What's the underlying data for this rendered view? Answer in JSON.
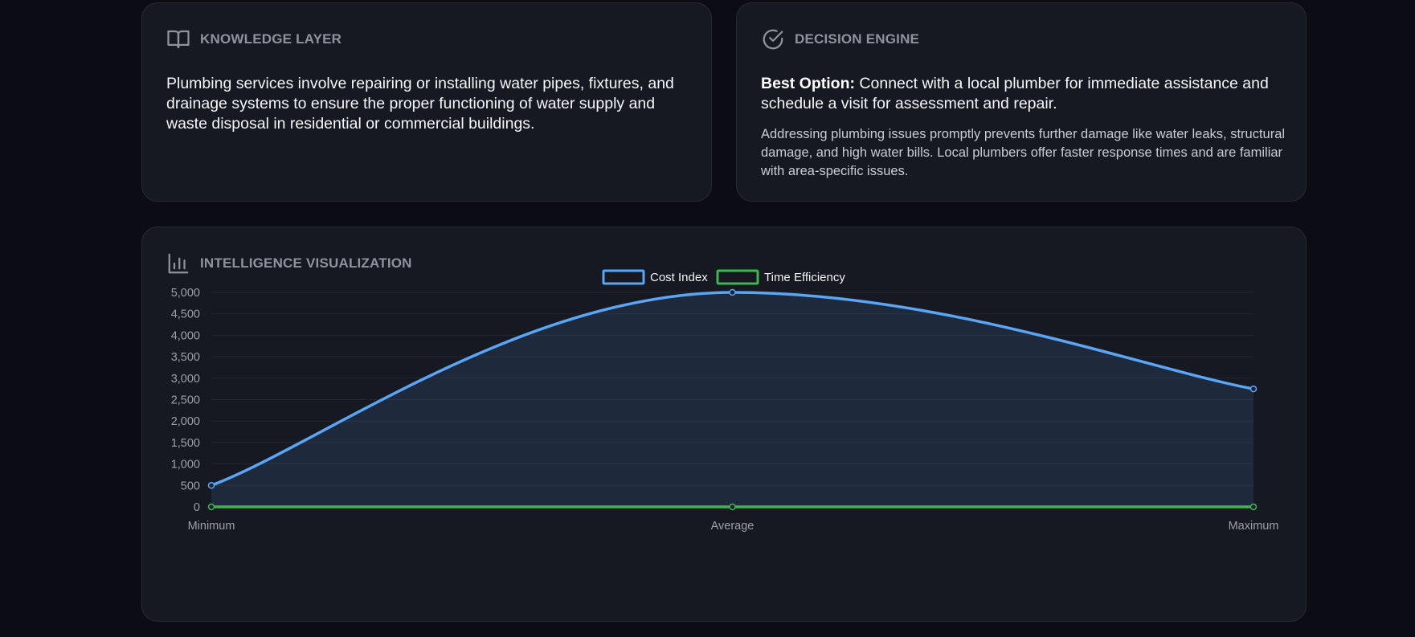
{
  "knowledge": {
    "title": "KNOWLEDGE LAYER",
    "icon": "book-open-icon",
    "text": "Plumbing services involve repairing or installing water pipes, fixtures, and drainage systems to ensure the proper functioning of water supply and waste disposal in residential or commercial buildings."
  },
  "decision": {
    "title": "DECISION ENGINE",
    "icon": "check-circle-icon",
    "best_label": "Best Option:",
    "best_text": " Connect with a local plumber for immediate assistance and schedule a visit for assessment and repair.",
    "reason": "Addressing plumbing issues promptly prevents further damage like water leaks, structural damage, and high water bills. Local plumbers offer faster response times and are familiar with area-specific issues."
  },
  "visualization": {
    "title": "INTELLIGENCE VISUALIZATION",
    "icon": "bar-chart-icon"
  },
  "colors": {
    "page_background": "#0c0d14",
    "card_background": "#161921",
    "cost_index": "#5ba5f5",
    "time_efficiency": "#3fb54f",
    "header_text": "#8e939e"
  },
  "chart_data": {
    "type": "line",
    "categories": [
      "Minimum",
      "Average",
      "Maximum"
    ],
    "series": [
      {
        "name": "Cost Index",
        "values": [
          500,
          5000,
          2750
        ],
        "color": "#5ba5f5",
        "fill": true
      },
      {
        "name": "Time Efficiency",
        "values": [
          0,
          0,
          0
        ],
        "color": "#3fb54f",
        "fill": false
      }
    ],
    "ylim": [
      0,
      5000
    ],
    "yticks": [
      "0",
      "500",
      "1,000",
      "1,500",
      "2,000",
      "2,500",
      "3,000",
      "3,500",
      "4,000",
      "4,500",
      "5,000"
    ],
    "ytick_values": [
      0,
      500,
      1000,
      1500,
      2000,
      2500,
      3000,
      3500,
      4000,
      4500,
      5000
    ],
    "grid": true,
    "legend_position": "top-center",
    "smooth": true
  }
}
